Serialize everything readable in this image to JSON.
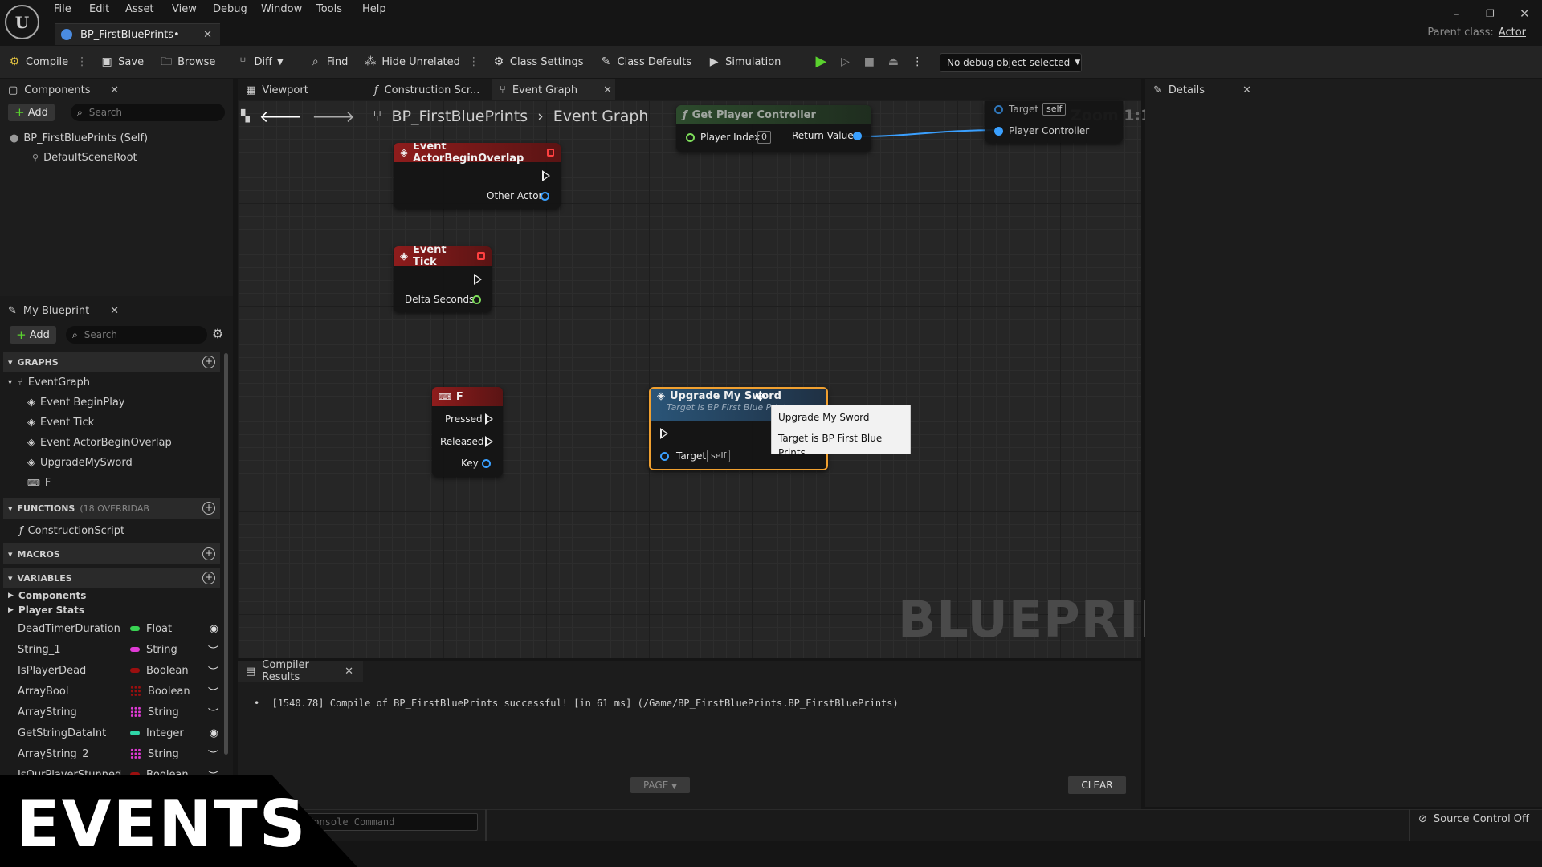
{
  "menu": [
    "File",
    "Edit",
    "Asset",
    "View",
    "Debug",
    "Window",
    "Tools",
    "Help"
  ],
  "document_tab": {
    "title": "BP_FirstBluePrints•"
  },
  "parent_class": {
    "label": "Parent class:",
    "value": "Actor"
  },
  "toolbar": {
    "compile": "Compile",
    "save": "Save",
    "browse": "Browse",
    "diff": "Diff",
    "find": "Find",
    "hide_unrelated": "Hide Unrelated",
    "class_settings": "Class Settings",
    "class_defaults": "Class Defaults",
    "simulation": "Simulation",
    "debug_object": "No debug object selected"
  },
  "components": {
    "tab": "Components",
    "add": "Add",
    "search_placeholder": "Search",
    "root": "BP_FirstBluePrints (Self)",
    "child": "DefaultSceneRoot"
  },
  "my_blueprint": {
    "tab": "My Blueprint",
    "add": "Add",
    "search_placeholder": "Search",
    "graphs_header": "GRAPHS",
    "event_graph": "EventGraph",
    "graph_items": [
      "Event BeginPlay",
      "Event Tick",
      "Event ActorBeginOverlap",
      "UpgradeMySword",
      "F"
    ],
    "functions_header": "FUNCTIONS",
    "functions_count": "(18 OVERRIDAB",
    "functions": [
      "ConstructionScript"
    ],
    "macros_header": "MACROS",
    "variables_header": "VARIABLES",
    "variable_groups": [
      "Components",
      "Player Stats"
    ],
    "variables": [
      {
        "name": "DeadTimerDuration",
        "type": "Float",
        "color": "#39d353",
        "array": false,
        "visible": true
      },
      {
        "name": "String_1",
        "type": "String",
        "color": "#e03bd6",
        "array": false,
        "visible": false
      },
      {
        "name": "IsPlayerDead",
        "type": "Boolean",
        "color": "#9b0f0f",
        "array": false,
        "visible": false
      },
      {
        "name": "ArrayBool",
        "type": "Boolean",
        "color": "#9b0f0f",
        "array": true,
        "visible": false
      },
      {
        "name": "ArrayString",
        "type": "String",
        "color": "#e03bd6",
        "array": true,
        "visible": false
      },
      {
        "name": "GetStringDataInt",
        "type": "Integer",
        "color": "#2fd6a8",
        "array": false,
        "visible": true
      },
      {
        "name": "ArrayString_2",
        "type": "String",
        "color": "#e03bd6",
        "array": true,
        "visible": false
      },
      {
        "name": "IsOurPlayerStunned",
        "type": "Boolean",
        "color": "#9b0f0f",
        "array": false,
        "visible": false
      }
    ]
  },
  "graph_tabs": {
    "viewport": "Viewport",
    "construction": "Construction Scr...",
    "event_graph": "Event Graph"
  },
  "breadcrumb": {
    "blueprint": "BP_FirstBluePrints",
    "graph": "Event Graph"
  },
  "zoom": "Zoom 1:1",
  "watermark": "BLUEPRINT",
  "nodes": {
    "actor_overlap": {
      "title": "Event ActorBeginOverlap",
      "pin": "Other Actor"
    },
    "tick": {
      "title": "Event Tick",
      "pin": "Delta Seconds"
    },
    "key_f": {
      "title": "F",
      "pins": [
        "Pressed",
        "Released",
        "Key"
      ]
    },
    "get_pc": {
      "title": "Get Player Controller",
      "index_label": "Player Index",
      "index_value": "0",
      "return": "Return Value"
    },
    "partial": {
      "target": "Target",
      "self": "self",
      "pc": "Player Controller"
    },
    "upgrade": {
      "title": "Upgrade My Sword",
      "subtitle": "Target is BP First Blue Prints",
      "target": "Target",
      "self": "self"
    }
  },
  "tooltip": {
    "line1": "Upgrade My Sword",
    "line2": "Target is BP First Blue Prints"
  },
  "details": {
    "tab": "Details"
  },
  "compiler": {
    "tab": "Compiler Results",
    "log": "[1540.78] Compile of BP_FirstBluePrints successful! [in 61 ms] (/Game/BP_FirstBluePrints.BP_FirstBluePrints)",
    "page": "PAGE",
    "clear": "CLEAR"
  },
  "status": {
    "console_placeholder": "Console Command",
    "source_control": "Source Control Off"
  },
  "overlay": {
    "text": "EVENTS"
  }
}
